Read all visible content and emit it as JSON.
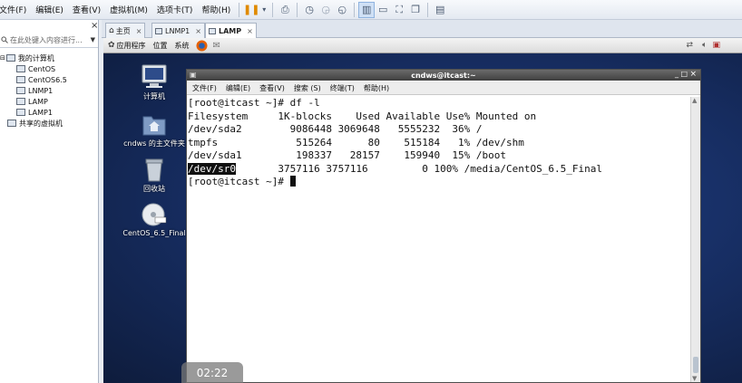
{
  "menubar": {
    "items": [
      "文件(F)",
      "编辑(E)",
      "查看(V)",
      "虚拟机(M)",
      "选项卡(T)",
      "帮助(H)"
    ]
  },
  "sidebar": {
    "close_label": "×",
    "search_placeholder": "在此处键入内容进行...",
    "tree": [
      {
        "label": "我的计算机",
        "level": 0
      },
      {
        "label": "CentOS",
        "level": 1
      },
      {
        "label": "CentOS6.5",
        "level": 1
      },
      {
        "label": "LNMP1",
        "level": 1
      },
      {
        "label": "LAMP",
        "level": 1
      },
      {
        "label": "LAMP1",
        "level": 1
      },
      {
        "label": "共享的虚拟机",
        "level": 0
      }
    ]
  },
  "tabs": [
    {
      "label": "主页",
      "active": false
    },
    {
      "label": "LNMP1",
      "active": false
    },
    {
      "label": "LAMP",
      "active": true
    }
  ],
  "gnome_panel": {
    "applications": "应用程序",
    "places": "位置",
    "system": "系统"
  },
  "desktop_icons": [
    {
      "label": "计算机",
      "icon": "computer-icon"
    },
    {
      "label": "cndws 的主文件夹",
      "icon": "home-folder-icon"
    },
    {
      "label": "回收站",
      "icon": "trash-icon"
    },
    {
      "label": "CentOS_6.5_Final",
      "icon": "dvd-icon"
    }
  ],
  "terminal": {
    "title": "cndws@itcast:~",
    "menu": [
      "文件(F)",
      "编辑(E)",
      "查看(V)",
      "搜索 (S)",
      "终端(T)",
      "帮助(H)"
    ],
    "lines": [
      "[root@itcast ~]# df -l",
      "Filesystem     1K-blocks    Used Available Use% Mounted on",
      "/dev/sda2        9086448 3069648   5555232  36% /",
      "tmpfs             515264      80    515184   1% /dev/shm",
      "/dev/sda1         198337   28157    159940  15% /boot"
    ],
    "sr0_device": "/dev/sr0",
    "sr0_rest": "       3757116 3757116         0 100% /media/CentOS_6.5_Final",
    "prompt": "[root@itcast ~]# "
  },
  "clock": {
    "time": "02:22"
  },
  "colors": {
    "desktop": "#1a3470",
    "terminal_bg": "#ffffff",
    "accent": "#8fb3df"
  }
}
